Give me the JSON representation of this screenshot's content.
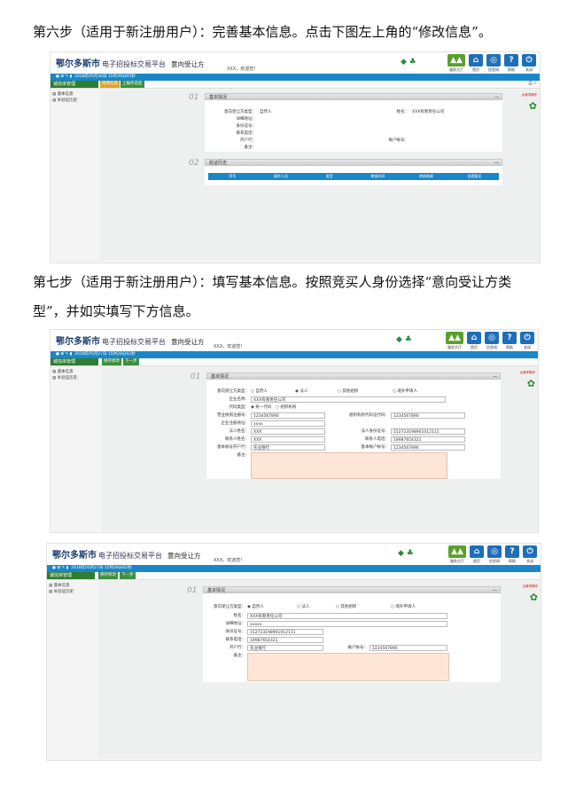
{
  "paragraphs": {
    "step6": "第六步（适用于新注册用户）：完善基本信息。点击下图左上角的“修改信息”。",
    "step7_line1": "第七步（适用于新注册用户）：填写基本信息。按照竞买人身份选择“意向受让方类",
    "step7_line2": "型”，并如实填写下方信息。"
  },
  "app": {
    "logo_city": "鄂尔多斯市",
    "logo_sub": "电子招投标交易平台",
    "module": "意向受让方",
    "welcome": "XXX，欢迎您！",
    "sidebar_title": "诚信库管理",
    "sidebar_items": [
      "基本信息",
      "补验证历史"
    ],
    "header_icons": [
      {
        "icon": "hall-icon",
        "label": "服务大厅",
        "color": "#5aa02c"
      },
      {
        "icon": "home-icon",
        "label": "首页",
        "color": "#1f6fb8"
      },
      {
        "icon": "globe-icon",
        "label": "信息网",
        "color": "#1f6fb8"
      },
      {
        "icon": "help-icon",
        "label": "帮助",
        "color": "#1f6fb8"
      },
      {
        "icon": "power-icon",
        "label": "关闭",
        "color": "#1f6fb8"
      }
    ],
    "section_basic": "基本情况",
    "section_history": "验证历史",
    "num_01": "01",
    "num_02": "02",
    "mascot_tag": "点我学操作"
  },
  "shot1": {
    "datetime": "2018年05月30日 15时39分05秒",
    "tabs": [
      "修改信息",
      "上报作造变"
    ],
    "fields": {
      "type_label": "意向受让方类型：",
      "type_value": "自然人",
      "name_label": "姓名：",
      "name_value": "XXX有限责任公司",
      "addr_label": "详细地址：",
      "id_label": "身份证号：",
      "phone_label": "联系电话：",
      "bank_label": "开户行：",
      "account_label": "账户帐号：",
      "remark_label": "备注："
    },
    "history_cols": [
      "序号",
      "操作人员",
      "类型",
      "审核时间",
      "审核结果",
      "处理意见"
    ]
  },
  "shot2": {
    "datetime": "2018年05月27日 15时28分02秒",
    "tabs": [
      "保存修改",
      "下一步"
    ],
    "type_label": "意向受让方类型：",
    "type_options": [
      "自然人",
      "法人",
      "其他组织",
      "境外申请人"
    ],
    "fields": {
      "company_label": "企业名称：",
      "company_value": "XXX有限责任公司",
      "code_label": "代码类型：",
      "code_opts": [
        "统一代码",
        "组织机构"
      ],
      "license_label": "营业执照注册号：",
      "license_value": "1234567890",
      "org_label": "组织机构代码证代码：",
      "org_value": "1234567890",
      "reg_addr_label": "企业注册地址：",
      "reg_addr_value": "xxxx",
      "legal_label": "法人姓名：",
      "legal_value": "XXX",
      "legal_id_label": "法人身份证号：",
      "legal_id_value": "152723198901012111",
      "contact_label": "联系人姓名：",
      "contact_value": "XXX",
      "contact_phone_label": "联系人电话：",
      "contact_phone_value": "18987654321",
      "bank_label": "基本帐号开户行：",
      "bank_value": "农业银行",
      "account_label": "基本帐户帐号：",
      "account_value": "1234567890",
      "remark_label": "备注："
    }
  },
  "shot3": {
    "datetime": "2018年05月27日 15时28分02秒",
    "tabs": [
      "保存修改",
      "下一步"
    ],
    "type_label": "意向受让方类型：",
    "type_options": [
      "自然人",
      "法人",
      "其他组织",
      "境外申请人"
    ],
    "fields": {
      "name_label": "姓名：",
      "name_value": "XXX有限责任公司",
      "addr_label": "详细地址：",
      "addr_value": "xxxxx",
      "id_label": "身份证号：",
      "id_value": "152723198901012111",
      "phone_label": "联系电话：",
      "phone_value": "18987654321",
      "bank_label": "开户行：",
      "bank_value": "农业银行",
      "account_label": "账户帐号：",
      "account_value": "1234567890",
      "remark_label": "备注："
    }
  }
}
